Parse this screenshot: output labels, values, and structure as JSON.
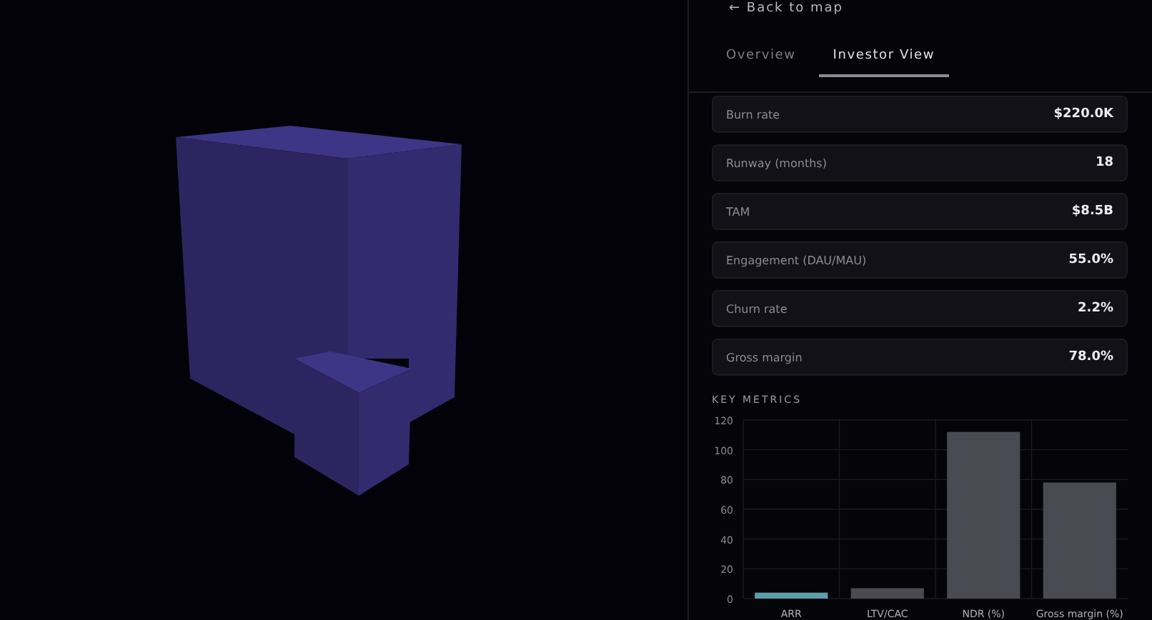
{
  "back_link": "← Back to map",
  "tabs": [
    {
      "label": "Overview",
      "selected": false
    },
    {
      "label": "Investor View",
      "selected": true
    }
  ],
  "metrics": [
    {
      "label": "Burn rate",
      "value": "$220.0K"
    },
    {
      "label": "Runway (months)",
      "value": "18"
    },
    {
      "label": "TAM",
      "value": "$8.5B"
    },
    {
      "label": "Engagement (DAU/MAU)",
      "value": "55.0%"
    },
    {
      "label": "Churn rate",
      "value": "2.2%"
    },
    {
      "label": "Gross margin",
      "value": "78.0%"
    }
  ],
  "key_metrics": {
    "title": "KEY METRICS",
    "chart_data": {
      "type": "bar",
      "categories": [
        "ARR",
        "LTV/CAC",
        "NDR (%)",
        "Gross margin (%)"
      ],
      "series": [
        {
          "color": "#5f9ea8",
          "values": [
            4,
            null,
            null,
            null
          ]
        },
        {
          "color": "#4a4a52",
          "values": [
            null,
            7,
            112,
            78
          ]
        }
      ],
      "grid": true,
      "ylim": [
        0,
        120
      ],
      "yticks": [
        0,
        20,
        40,
        60,
        80,
        100,
        120
      ]
    }
  }
}
